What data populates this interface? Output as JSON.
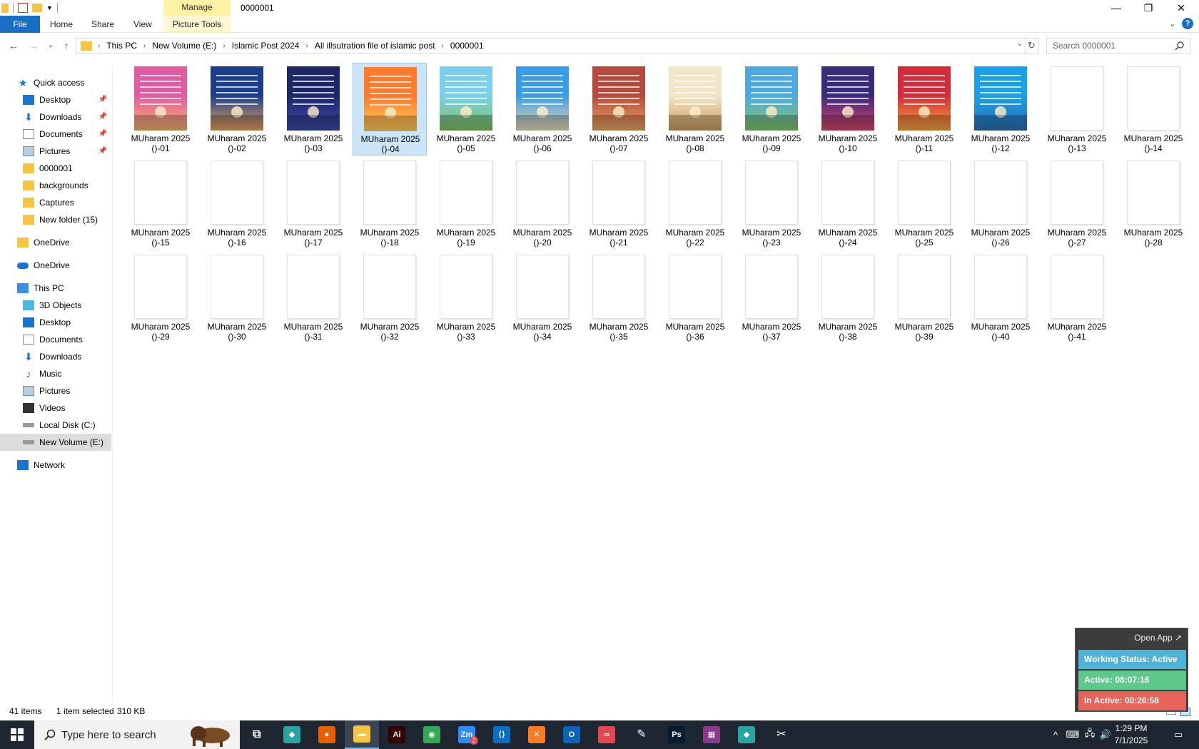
{
  "window": {
    "title": "0000001",
    "contextual_tab_group": "Manage",
    "minimize": "—",
    "restore": "❐",
    "close": "✕"
  },
  "ribbon": {
    "tabs": [
      "File",
      "Home",
      "Share",
      "View",
      "Picture Tools"
    ],
    "collapse": "⌄",
    "help": "?"
  },
  "navigation": {
    "back": "←",
    "forward": "→",
    "recent": "⌄",
    "up": "↑",
    "breadcrumbs": [
      "This PC",
      "New Volume (E:)",
      "Islamic Post 2024",
      "All illsutration file of islamic post",
      "0000001"
    ],
    "refresh": "↻",
    "search_placeholder": "Search 0000001"
  },
  "sidebar": {
    "items": [
      {
        "label": "Quick access",
        "icon": "star-icon",
        "pinned": false
      },
      {
        "label": "Desktop",
        "icon": "desktop-icon",
        "pinned": true
      },
      {
        "label": "Downloads",
        "icon": "download-icon",
        "pinned": true
      },
      {
        "label": "Documents",
        "icon": "documents-icon",
        "pinned": true
      },
      {
        "label": "Pictures",
        "icon": "pictures-icon",
        "pinned": true
      },
      {
        "label": "0000001",
        "icon": "folder-icon",
        "pinned": false
      },
      {
        "label": "backgrounds",
        "icon": "folder-icon",
        "pinned": false
      },
      {
        "label": "Captures",
        "icon": "folder-icon",
        "pinned": false
      },
      {
        "label": "New folder (15)",
        "icon": "folder-icon",
        "pinned": false
      },
      {
        "label": "OneDrive",
        "icon": "folder-icon",
        "pinned": false
      },
      {
        "label": "OneDrive",
        "icon": "cloud-icon",
        "pinned": false
      },
      {
        "label": "This PC",
        "icon": "computer-icon",
        "pinned": false
      },
      {
        "label": "3D Objects",
        "icon": "cube-icon",
        "pinned": false
      },
      {
        "label": "Desktop",
        "icon": "desktop-icon",
        "pinned": false
      },
      {
        "label": "Documents",
        "icon": "documents-icon",
        "pinned": false
      },
      {
        "label": "Downloads",
        "icon": "download-icon",
        "pinned": false
      },
      {
        "label": "Music",
        "icon": "music-icon",
        "pinned": false
      },
      {
        "label": "Pictures",
        "icon": "pictures-icon",
        "pinned": false
      },
      {
        "label": "Videos",
        "icon": "video-icon",
        "pinned": false
      },
      {
        "label": "Local Disk (C:)",
        "icon": "drive-icon",
        "pinned": false
      },
      {
        "label": "New Volume (E:)",
        "icon": "drive-icon",
        "pinned": false
      },
      {
        "label": "Network",
        "icon": "network-icon",
        "pinned": false
      }
    ],
    "pin_glyph": "📌"
  },
  "files": [
    {
      "line1": "MUharam 2025",
      "line2": "()-01",
      "colors": [
        "#e25aa0",
        "#f3b36b"
      ]
    },
    {
      "line1": "MUharam 2025",
      "line2": "()-02",
      "colors": [
        "#1b3f8a",
        "#e8a15a"
      ]
    },
    {
      "line1": "MUharam 2025",
      "line2": "()-03",
      "colors": [
        "#1c2766",
        "#3a4aa8"
      ]
    },
    {
      "line1": "MUharam 2025",
      "line2": "()-04",
      "colors": [
        "#ff7b2e",
        "#ffcf5a"
      ]
    },
    {
      "line1": "MUharam 2025",
      "line2": "()-05",
      "colors": [
        "#7ccfea",
        "#7bbf5a"
      ]
    },
    {
      "line1": "MUharam 2025",
      "line2": "()-06",
      "colors": [
        "#3a9be8",
        "#e8d9b0"
      ]
    },
    {
      "line1": "MUharam 2025",
      "line2": "()-07",
      "colors": [
        "#b44a3c",
        "#e8a360"
      ]
    },
    {
      "line1": "MUharam 2025",
      "line2": "()-08",
      "colors": [
        "#f3e6c8",
        "#c89a5c"
      ]
    },
    {
      "line1": "MUharam 2025",
      "line2": "()-09",
      "colors": [
        "#4ea9e0",
        "#7ec463"
      ]
    },
    {
      "line1": "MUharam 2025",
      "line2": "()-10",
      "colors": [
        "#3a2a7a",
        "#d9456a"
      ]
    },
    {
      "line1": "MUharam 2025",
      "line2": "()-11",
      "colors": [
        "#d42a3a",
        "#f3a53a"
      ]
    },
    {
      "line1": "MUharam 2025",
      "line2": "()-12",
      "colors": [
        "#1aa0e8",
        "#2a6fb0"
      ]
    },
    {
      "line1": "MUharam 2025",
      "line2": "()-13"
    },
    {
      "line1": "MUharam 2025",
      "line2": "()-14"
    },
    {
      "line1": "MUharam 2025",
      "line2": "()-15"
    },
    {
      "line1": "MUharam 2025",
      "line2": "()-16"
    },
    {
      "line1": "MUharam 2025",
      "line2": "()-17"
    },
    {
      "line1": "MUharam 2025",
      "line2": "()-18"
    },
    {
      "line1": "MUharam 2025",
      "line2": "()-19"
    },
    {
      "line1": "MUharam 2025",
      "line2": "()-20"
    },
    {
      "line1": "MUharam 2025",
      "line2": "()-21"
    },
    {
      "line1": "MUharam 2025",
      "line2": "()-22"
    },
    {
      "line1": "MUharam 2025",
      "line2": "()-23"
    },
    {
      "line1": "MUharam 2025",
      "line2": "()-24"
    },
    {
      "line1": "MUharam 2025",
      "line2": "()-25"
    },
    {
      "line1": "MUharam 2025",
      "line2": "()-26"
    },
    {
      "line1": "MUharam 2025",
      "line2": "()-27"
    },
    {
      "line1": "MUharam 2025",
      "line2": "()-28"
    },
    {
      "line1": "MUharam 2025",
      "line2": "()-29"
    },
    {
      "line1": "MUharam 2025",
      "line2": "()-30"
    },
    {
      "line1": "MUharam 2025",
      "line2": "()-31"
    },
    {
      "line1": "MUharam 2025",
      "line2": "()-32"
    },
    {
      "line1": "MUharam 2025",
      "line2": "()-33"
    },
    {
      "line1": "MUharam 2025",
      "line2": "()-34"
    },
    {
      "line1": "MUharam 2025",
      "line2": "()-35"
    },
    {
      "line1": "MUharam 2025",
      "line2": "()-36"
    },
    {
      "line1": "MUharam 2025",
      "line2": "()-37"
    },
    {
      "line1": "MUharam 2025",
      "line2": "()-38"
    },
    {
      "line1": "MUharam 2025",
      "line2": "()-39"
    },
    {
      "line1": "MUharam 2025",
      "line2": "()-40"
    },
    {
      "line1": "MUharam 2025",
      "line2": "()-41"
    }
  ],
  "selected_file": "()-04",
  "status": {
    "item_count": "41 items",
    "selection": "1 item selected",
    "size": "310 KB"
  },
  "widget": {
    "open_app": "Open App ↗",
    "working_status": "Working Status: Active",
    "active": "Active: 08:07:16",
    "inactive": "In Active: 00:26:58",
    "colors": {
      "status": "#4fb3d9",
      "active": "#5cc98a",
      "inactive": "#e8635a"
    }
  },
  "taskbar": {
    "search_placeholder": "Type here to search",
    "apps": [
      {
        "name": "task-view-icon",
        "glyph": "⧉",
        "bg": "transparent"
      },
      {
        "name": "app-icon",
        "glyph": "◆",
        "bg": "#2aa3a3"
      },
      {
        "name": "firefox-icon",
        "glyph": "●",
        "bg": "#e66000"
      },
      {
        "name": "file-explorer-icon",
        "glyph": "▬",
        "bg": "#f5c542"
      },
      {
        "name": "illustrator-icon",
        "glyph": "Ai",
        "bg": "#330000"
      },
      {
        "name": "chrome-icon",
        "glyph": "◉",
        "bg": "#34a853"
      },
      {
        "name": "zoom-icon",
        "glyph": "Zm",
        "bg": "#2d8cff"
      },
      {
        "name": "vscode-icon",
        "glyph": "⟨⟩",
        "bg": "#0a6fc2"
      },
      {
        "name": "xampp-icon",
        "glyph": "✕",
        "bg": "#fb7a24"
      },
      {
        "name": "outlook-icon",
        "glyph": "O",
        "bg": "#0a64b8"
      },
      {
        "name": "creative-cloud-icon",
        "glyph": "∞",
        "bg": "#e34850"
      },
      {
        "name": "pen-tool-icon",
        "glyph": "✎",
        "bg": "transparent"
      },
      {
        "name": "photoshop-icon",
        "glyph": "Ps",
        "bg": "#001d34"
      },
      {
        "name": "winrar-icon",
        "glyph": "▦",
        "bg": "#8a3a8a"
      },
      {
        "name": "app-icon-2",
        "glyph": "◆",
        "bg": "#2aa3a3"
      },
      {
        "name": "snipping-icon",
        "glyph": "✂",
        "bg": "transparent"
      }
    ],
    "zoom_badge": "2",
    "tray": {
      "chevron": "^",
      "time": "1:29 PM",
      "date": "7/1/2025"
    }
  }
}
